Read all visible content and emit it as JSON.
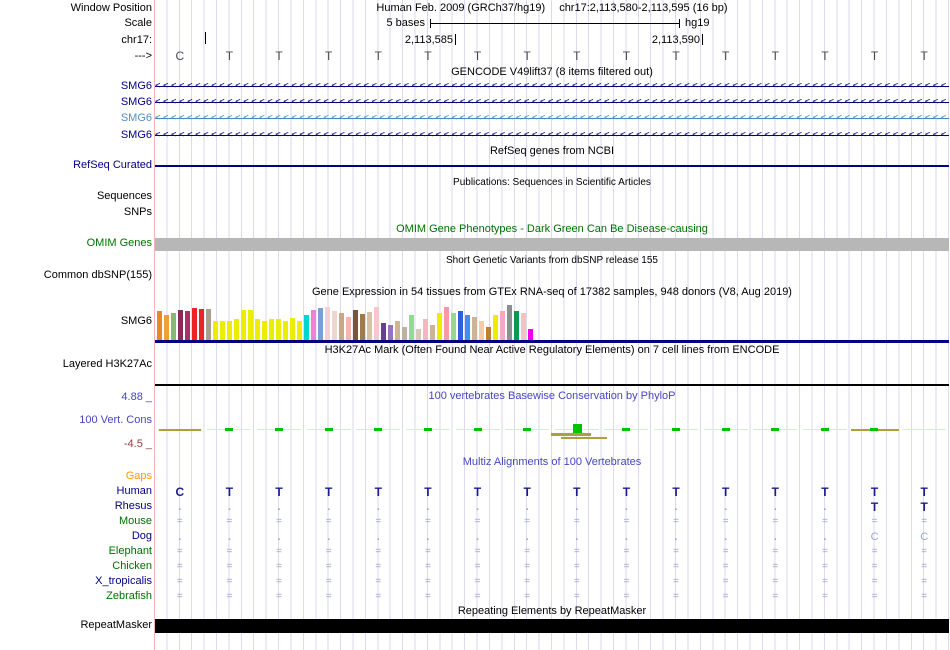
{
  "header": {
    "window_position_label": "Window Position",
    "assembly": "Human Feb. 2009 (GRCh37/hg19)",
    "position": "chr17:2,113,580-2,113,595 (16 bp)",
    "scale_label": "Scale",
    "scale_value": "5 bases",
    "scale_assembly": "hg19",
    "chrom_label": "chr17:",
    "ruler_numbers": [
      "2,113,585",
      "2,113,590"
    ],
    "strand_label": "--->"
  },
  "sequence": [
    "C",
    "T",
    "T",
    "T",
    "T",
    "T",
    "T",
    "T",
    "T",
    "T",
    "T",
    "T",
    "T",
    "T",
    "T",
    "T"
  ],
  "tracks": {
    "gencode": {
      "title": "GENCODE V49lift37 (8 items filtered out)",
      "arrow_glyph": "<",
      "items": [
        {
          "label": "SMG6",
          "color": "navy"
        },
        {
          "label": "SMG6",
          "color": "navy"
        },
        {
          "label": "SMG6",
          "color": "blue2"
        },
        {
          "label": "SMG6",
          "color": "navy"
        }
      ]
    },
    "refseq": {
      "title": "RefSeq genes from NCBI",
      "label": "RefSeq Curated"
    },
    "publications": {
      "title": "Publications: Sequences in Scientific Articles",
      "labels": [
        "Sequences",
        "SNPs"
      ]
    },
    "omim": {
      "title": "OMIM Gene Phenotypes - Dark Green Can Be Disease-causing",
      "label": "OMIM Genes"
    },
    "dbsnp": {
      "title": "Short Genetic Variants from dbSNP release 155",
      "label": "Common dbSNP(155)"
    },
    "gtex": {
      "title": "Gene Expression in 54 tissues from GTEx RNA-seq of 17382 samples, 948 donors (V8, Aug 2019)",
      "label": "SMG6",
      "bars": [
        {
          "c": "#e8882a",
          "h": 29
        },
        {
          "c": "#f0a030",
          "h": 25
        },
        {
          "c": "#86b878",
          "h": 27
        },
        {
          "c": "#8b2a5a",
          "h": 30
        },
        {
          "c": "#a83268",
          "h": 29
        },
        {
          "c": "#ee2222",
          "h": 32
        },
        {
          "c": "#ee2222",
          "h": 31
        },
        {
          "c": "#aa9f8f",
          "h": 31
        },
        {
          "c": "#eded00",
          "h": 19
        },
        {
          "c": "#eded00",
          "h": 19
        },
        {
          "c": "#eded00",
          "h": 19
        },
        {
          "c": "#eded00",
          "h": 21
        },
        {
          "c": "#eded00",
          "h": 30
        },
        {
          "c": "#eded00",
          "h": 30
        },
        {
          "c": "#eded00",
          "h": 21
        },
        {
          "c": "#eded00",
          "h": 19
        },
        {
          "c": "#eded00",
          "h": 21
        },
        {
          "c": "#eded00",
          "h": 21
        },
        {
          "c": "#eded00",
          "h": 19
        },
        {
          "c": "#eded00",
          "h": 22
        },
        {
          "c": "#eded00",
          "h": 19
        },
        {
          "c": "#00d5d5",
          "h": 25
        },
        {
          "c": "#ef7fd8",
          "h": 30
        },
        {
          "c": "#7b9fd4",
          "h": 32
        },
        {
          "c": "#f4cfd4",
          "h": 33
        },
        {
          "c": "#eed5cf",
          "h": 29
        },
        {
          "c": "#c9a887",
          "h": 27
        },
        {
          "c": "#f2b6ab",
          "h": 23
        },
        {
          "c": "#77553a",
          "h": 30
        },
        {
          "c": "#9c7a54",
          "h": 26
        },
        {
          "c": "#d9c1a6",
          "h": 28
        },
        {
          "c": "#f9c6d0",
          "h": 33
        },
        {
          "c": "#6a3d9a",
          "h": 17
        },
        {
          "c": "#9a6fc4",
          "h": 15
        },
        {
          "c": "#cdb493",
          "h": 19
        },
        {
          "c": "#bfb0a2",
          "h": 13
        },
        {
          "c": "#8fdc8f",
          "h": 25
        },
        {
          "c": "#d7c8b8",
          "h": 11
        },
        {
          "c": "#f6b6c0",
          "h": 21
        },
        {
          "c": "#cdb493",
          "h": 15
        },
        {
          "c": "#eded00",
          "h": 27
        },
        {
          "c": "#f799a9",
          "h": 33
        },
        {
          "c": "#99d68f",
          "h": 27
        },
        {
          "c": "#2f5ddd",
          "h": 29
        },
        {
          "c": "#3f8ef2",
          "h": 25
        },
        {
          "c": "#cdb493",
          "h": 23
        },
        {
          "c": "#f5cba7",
          "h": 19
        },
        {
          "c": "#c07f2f",
          "h": 13
        },
        {
          "c": "#eded00",
          "h": 25
        },
        {
          "c": "#f8a9c0",
          "h": 29
        },
        {
          "c": "#8f8f8f",
          "h": 35
        },
        {
          "c": "#0a9a50",
          "h": 29
        },
        {
          "c": "#f4c2c2",
          "h": 27
        },
        {
          "c": "#ee00ee",
          "h": 11
        }
      ]
    },
    "h3k27ac": {
      "title": "H3K27Ac Mark (Often Found Near Active Regulatory Elements) on 7 cell lines from ENCODE",
      "label": "Layered H3K27Ac"
    },
    "conservation": {
      "title": "100 vertebrates Basewise Conservation by PhyloP",
      "label": "100 Vert. Cons",
      "max_label": "4.88 _",
      "min_label": "-4.5 _",
      "marks": [
        "olive",
        "green",
        "green",
        "green",
        "green",
        "green",
        "green",
        "green",
        "peak",
        "green",
        "green",
        "green",
        "green",
        "green",
        "olive_green",
        "pale"
      ],
      "colors": {
        "green": "#00c300",
        "olive": "#aba03c",
        "pale": "#d6efd0"
      }
    },
    "multiz": {
      "title": "Multiz Alignments of 100 Vertebrates",
      "gaps_label": "Gaps",
      "rows": [
        {
          "name": "Human",
          "color": "navy",
          "strong": true,
          "cells": [
            "C",
            "T",
            "T",
            "T",
            "T",
            "T",
            "T",
            "T",
            "T",
            "T",
            "T",
            "T",
            "T",
            "T",
            "T",
            "T"
          ]
        },
        {
          "name": "Rhesus",
          "color": "navy",
          "strong": true,
          "cells": [
            ".",
            ".",
            ".",
            ".",
            ".",
            ".",
            ".",
            ".",
            ".",
            ".",
            ".",
            ".",
            ".",
            ".",
            "T",
            "T"
          ]
        },
        {
          "name": "Mouse",
          "color": "green",
          "strong": false,
          "cells": [
            "=",
            "=",
            "=",
            "=",
            "=",
            "=",
            "=",
            "=",
            "=",
            "=",
            "=",
            "=",
            "=",
            "=",
            "=",
            "="
          ]
        },
        {
          "name": "Dog",
          "color": "navy",
          "strong": false,
          "cells": [
            ".",
            ".",
            ".",
            ".",
            ".",
            ".",
            ".",
            ".",
            ".",
            ".",
            ".",
            ".",
            ".",
            ".",
            "C",
            "C"
          ]
        },
        {
          "name": "Elephant",
          "color": "green",
          "strong": false,
          "cells": [
            "=",
            "=",
            "=",
            "=",
            "=",
            "=",
            "=",
            "=",
            "=",
            "=",
            "=",
            "=",
            "=",
            "=",
            "=",
            "="
          ]
        },
        {
          "name": "Chicken",
          "color": "green",
          "strong": false,
          "cells": [
            "=",
            "=",
            "=",
            "=",
            "=",
            "=",
            "=",
            "=",
            "=",
            "=",
            "=",
            "=",
            "=",
            "=",
            "=",
            "="
          ]
        },
        {
          "name": "X_tropicalis",
          "color": "navy",
          "strong": false,
          "cells": [
            "=",
            "=",
            "=",
            "=",
            "=",
            "=",
            "=",
            "=",
            "=",
            "=",
            "=",
            "=",
            "=",
            "=",
            "=",
            "="
          ]
        },
        {
          "name": "Zebrafish",
          "color": "green",
          "strong": false,
          "cells": [
            "=",
            "=",
            "=",
            "=",
            "=",
            "=",
            "=",
            "=",
            "=",
            "=",
            "=",
            "=",
            "=",
            "=",
            "=",
            "="
          ]
        }
      ]
    },
    "repeatmasker": {
      "title": "Repeating Elements by RepeatMasker",
      "label": "RepeatMasker"
    }
  }
}
